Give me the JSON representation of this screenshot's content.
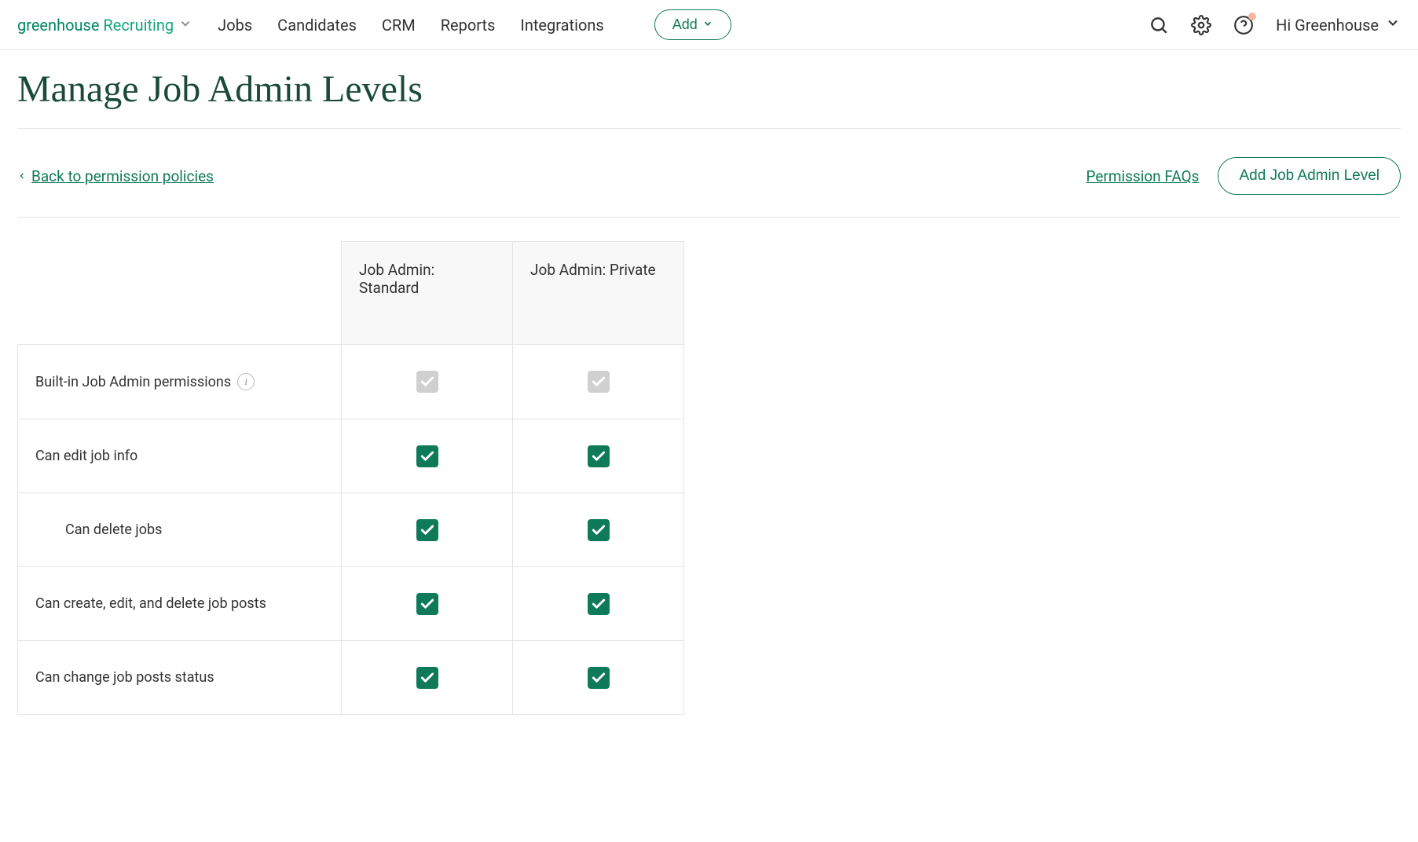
{
  "header": {
    "logo_part1": "greenhouse",
    "logo_part2": " Recruiting",
    "nav": [
      "Jobs",
      "Candidates",
      "CRM",
      "Reports",
      "Integrations"
    ],
    "add_label": "Add",
    "greeting": "Hi Greenhouse"
  },
  "page": {
    "title": "Manage Job Admin Levels",
    "back_link": "Back to permission policies",
    "faq_link": "Permission FAQs",
    "add_level_button": "Add Job Admin Level"
  },
  "table": {
    "columns": [
      "Job Admin: Standard",
      "Job Admin: Private"
    ],
    "rows": [
      {
        "label": "Built-in Job Admin permissions",
        "info": true,
        "indent": false,
        "values": [
          "disabled",
          "disabled"
        ]
      },
      {
        "label": "Can edit job info",
        "info": false,
        "indent": false,
        "values": [
          "enabled",
          "enabled"
        ]
      },
      {
        "label": "Can delete jobs",
        "info": false,
        "indent": true,
        "values": [
          "enabled",
          "enabled"
        ]
      },
      {
        "label": "Can create, edit, and delete job posts",
        "info": false,
        "indent": false,
        "values": [
          "enabled",
          "enabled"
        ]
      },
      {
        "label": "Can change job posts status",
        "info": false,
        "indent": false,
        "values": [
          "enabled",
          "enabled"
        ]
      }
    ]
  }
}
